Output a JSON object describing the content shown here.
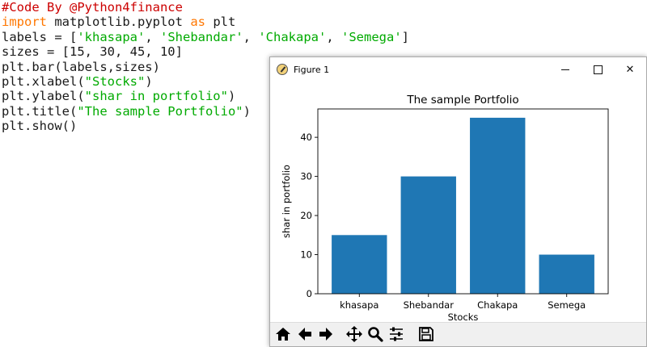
{
  "code": {
    "lines": [
      [
        {
          "t": "#Code By @Python4finance",
          "c": "comment"
        }
      ],
      [
        {
          "t": "import",
          "c": "kw"
        },
        {
          "t": " matplotlib.pyplot ",
          "c": "plain"
        },
        {
          "t": "as",
          "c": "kw"
        },
        {
          "t": " plt",
          "c": "plain"
        }
      ],
      [
        {
          "t": "labels = [",
          "c": "plain"
        },
        {
          "t": "'khasapa'",
          "c": "str"
        },
        {
          "t": ", ",
          "c": "plain"
        },
        {
          "t": "'Shebandar'",
          "c": "str"
        },
        {
          "t": ", ",
          "c": "plain"
        },
        {
          "t": "'Chakapa'",
          "c": "str"
        },
        {
          "t": ", ",
          "c": "plain"
        },
        {
          "t": "'Semega'",
          "c": "str"
        },
        {
          "t": "]",
          "c": "plain"
        }
      ],
      [
        {
          "t": "sizes = [15, 30, 45, 10]",
          "c": "plain"
        }
      ],
      [
        {
          "t": "plt.bar(labels,sizes)",
          "c": "plain"
        }
      ],
      [
        {
          "t": "plt.xlabel(",
          "c": "plain"
        },
        {
          "t": "\"Stocks\"",
          "c": "str"
        },
        {
          "t": ")",
          "c": "plain"
        }
      ],
      [
        {
          "t": "plt.ylabel(",
          "c": "plain"
        },
        {
          "t": "\"shar in portfolio\"",
          "c": "str"
        },
        {
          "t": ")",
          "c": "plain"
        }
      ],
      [
        {
          "t": "plt.title(",
          "c": "plain"
        },
        {
          "t": "\"The sample Portfolio\"",
          "c": "str"
        },
        {
          "t": ")",
          "c": "plain"
        }
      ],
      [
        {
          "t": "plt.show()",
          "c": "plain"
        }
      ]
    ],
    "colors": {
      "comment": "#cc0000",
      "keyword": "#ff7700",
      "string": "#00aa00",
      "plain": "#1a1a1a"
    }
  },
  "window": {
    "title": "Figure 1",
    "icons": {
      "app": "matplotlib-figure-icon",
      "minimize": "minimize-icon",
      "maximize": "maximize-icon",
      "close": "close-icon"
    },
    "close_glyph": "✕"
  },
  "toolbar": {
    "icons": [
      "home-icon",
      "back-arrow-icon",
      "forward-arrow-icon",
      "pan-icon",
      "zoom-icon",
      "configure-subplots-icon",
      "save-icon"
    ]
  },
  "chart_data": {
    "type": "bar",
    "title": "The sample Portfolio",
    "xlabel": "Stocks",
    "ylabel": "shar in portfolio",
    "categories": [
      "khasapa",
      "Shebandar",
      "Chakapa",
      "Semega"
    ],
    "values": [
      15,
      30,
      45,
      10
    ],
    "ylim": [
      0,
      47.25
    ],
    "yticks": [
      0,
      10,
      20,
      30,
      40
    ],
    "bar_color": "#1f77b4",
    "grid": false
  }
}
